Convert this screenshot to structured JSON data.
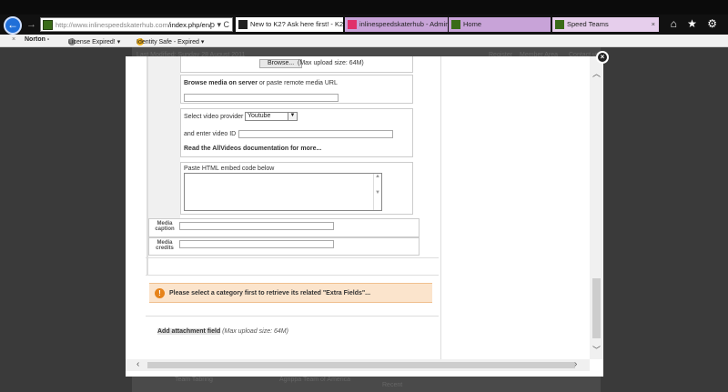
{
  "browser": {
    "url_host": "http://www.inlinespeedskaterhub.com",
    "url_path": "/index.php/en/",
    "address_controls": "ρ ▾ C",
    "tabs": [
      {
        "label": "New to K2? Ask here first! - K2...",
        "color": "#ffffff"
      },
      {
        "label": "inlinespeedskaterhub - Admini...",
        "color": "#c8a3d8"
      },
      {
        "label": "Home",
        "color": "#c8a3d8"
      },
      {
        "label": "Speed Teams",
        "color": "#e6ceec",
        "close": "×"
      }
    ],
    "tools": "⌂ ★ ⚙"
  },
  "norton_bar": {
    "close": "×",
    "brand": "Norton -",
    "license": "License Expired! ▾",
    "identity": "Identity Safe - Expired ▾"
  },
  "background_page": {
    "last_modified": "Last Modified: Sunday 28 August 2011",
    "register": "Register",
    "member_area": "Member Area",
    "contact": "Contact us",
    "footer_left": "Team Tabring",
    "footer_mid": "Agrippa Team of America",
    "footer_right": "Recent"
  },
  "modal": {
    "close": "×",
    "browse_label": "Browse...",
    "max_upload_top": "(Max upload size: 64M)",
    "browse_media_bold": "Browse media on server",
    "browse_media_rest": " or paste remote media URL",
    "video_provider_label": "Select video provider",
    "video_provider_value": "Youtube",
    "video_id_label": "and enter video ID",
    "allvideos_doc": "Read the AllVideos documentation for more...",
    "embed_label": "Paste HTML embed code below",
    "media_caption_label_1": "Media",
    "media_caption_label_2": "caption",
    "media_credits_label_1": "Media",
    "media_credits_label_2": "credits",
    "warning": "Please select a category first to retrieve its related \"Extra Fields\"...",
    "attachment_link": "Add attachment field",
    "attachment_note": " (Max upload size: 64M)"
  }
}
